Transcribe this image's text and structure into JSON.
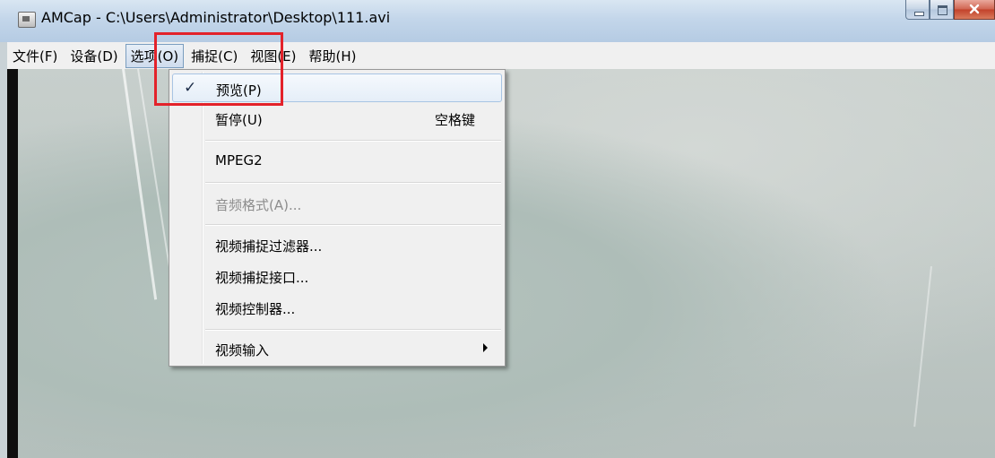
{
  "window": {
    "title": "AMCap - C:\\Users\\Administrator\\Desktop\\111.avi"
  },
  "menubar": {
    "items": [
      {
        "label": "文件(F)"
      },
      {
        "label": "设备(D)"
      },
      {
        "label": "选项(O)"
      },
      {
        "label": "捕捉(C)"
      },
      {
        "label": "视图(E)"
      },
      {
        "label": "帮助(H)"
      }
    ]
  },
  "options_menu": {
    "items": [
      {
        "label": "预览(P)",
        "checked": true
      },
      {
        "label": "暂停(U)",
        "shortcut": "空格键"
      },
      {
        "label": "MPEG2"
      },
      {
        "label": "音频格式(A)...",
        "disabled": true
      },
      {
        "label": "视频捕捉过滤器..."
      },
      {
        "label": "视频捕捉接口..."
      },
      {
        "label": "视频控制器..."
      },
      {
        "label": "视频输入",
        "submenu": true
      }
    ],
    "check_mark": "✓"
  },
  "colors": {
    "annotation": "#e3222a",
    "menu_bg": "#f0f0f0"
  },
  "icons": {
    "app": "amcap-app-icon",
    "check": "check-icon",
    "submenu": "submenu-arrow-icon"
  }
}
